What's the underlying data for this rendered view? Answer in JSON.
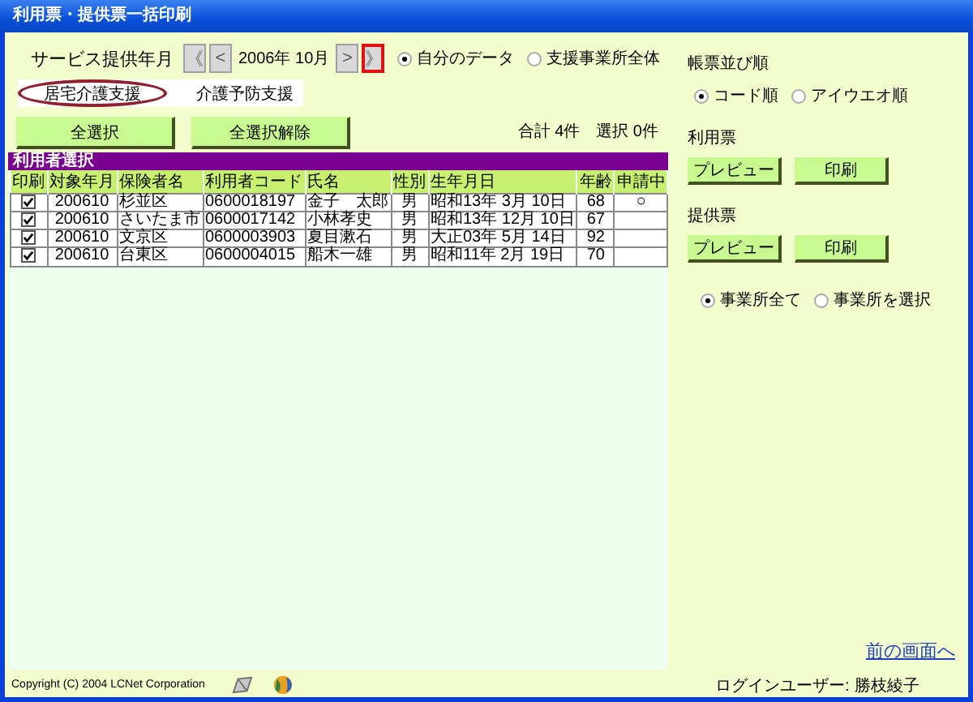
{
  "window": {
    "title": "利用票・提供票一括印刷"
  },
  "period": {
    "label": "サービス提供年月",
    "value": "2006年 10月",
    "nav": [
      {
        "kind": "prev",
        "label": "《",
        "focused": false
      },
      {
        "kind": "prev",
        "label": "<",
        "focused": false
      },
      {
        "kind": "next",
        "label": ">",
        "focused": false
      },
      {
        "kind": "next",
        "label": "》",
        "focused": true
      }
    ]
  },
  "scope": [
    {
      "label": "自分のデータ",
      "selected": true
    },
    {
      "label": "支援事業所全体",
      "selected": false
    }
  ],
  "service_tabs": [
    {
      "label": "居宅介護支援",
      "selected": true
    },
    {
      "label": "介護予防支援",
      "selected": false
    }
  ],
  "select_buttons": [
    "全選択",
    "全選択解除"
  ],
  "summary": [
    "合計 4件",
    "選択 0件"
  ],
  "table": {
    "title": "利用者選択",
    "columns": [
      "印刷",
      "対象年月",
      "保険者名",
      "利用者コード",
      "氏名",
      "性別",
      "生年月日",
      "年齢",
      "申請中"
    ],
    "rows": [
      {
        "checked": true,
        "cells": [
          "",
          "200610",
          "杉並区",
          "0600018197",
          "金子　太郎",
          "男",
          "昭和13年 3月 10日",
          "68",
          "○"
        ]
      },
      {
        "checked": true,
        "cells": [
          "",
          "200610",
          "さいたま市",
          "0600017142",
          "小林孝史",
          "男",
          "昭和13年 12月 10日",
          "67"
        ]
      },
      {
        "checked": true,
        "cells": [
          "",
          "200610",
          "文京区",
          "0600003903",
          "夏目漱石",
          "男",
          "大正03年 5月 14日",
          "92"
        ]
      },
      {
        "checked": true,
        "cells": [
          "",
          "200610",
          "台東区",
          "0600004015",
          "船木一雄",
          "男",
          "昭和11年 2月 19日",
          "70"
        ]
      }
    ]
  },
  "sort_order": {
    "title": "帳票並び順",
    "options": [
      {
        "label": "コード順",
        "selected": true
      },
      {
        "label": "アイウエオ順",
        "selected": false
      }
    ]
  },
  "slips": [
    {
      "title": "利用票",
      "buttons": [
        "プレビュー",
        "印刷"
      ]
    },
    {
      "title": "提供票",
      "buttons": [
        "プレビュー",
        "印刷"
      ]
    }
  ],
  "office_scope": [
    {
      "label": "事業所全て",
      "selected": true
    },
    {
      "label": "事業所を選択",
      "selected": false
    }
  ],
  "back_link": "前の画面へ",
  "footer": {
    "copyright": "Copyright (C) 2004 LCNet Corporation",
    "login_label": "ログインユーザー:",
    "login_user": "勝枝綾子"
  }
}
